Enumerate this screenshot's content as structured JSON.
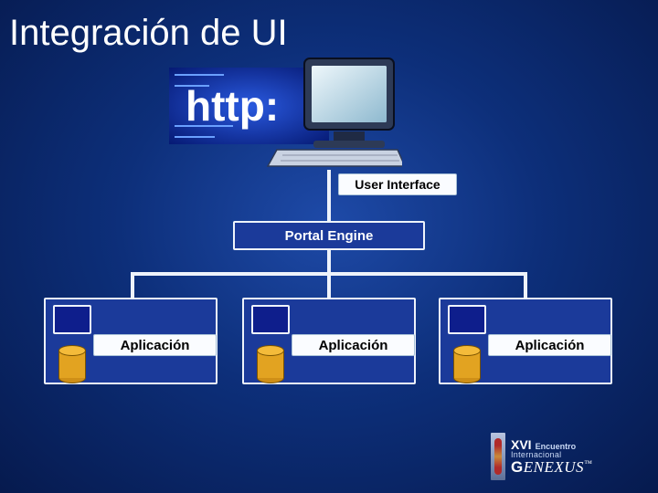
{
  "title": "Integración de UI",
  "http_text": "http:",
  "ui_label": "User Interface",
  "portal_label": "Portal Engine",
  "apps": [
    {
      "label": "Aplicación"
    },
    {
      "label": "Aplicación"
    },
    {
      "label": "Aplicación"
    }
  ],
  "logo": {
    "roman": "XVI",
    "line1": "Encuentro",
    "line2": "Internacional",
    "brand": "GeneXus"
  },
  "chart_data": {
    "type": "diagram",
    "title": "Integración de UI",
    "nodes": [
      {
        "id": "ui",
        "label": "User Interface",
        "note": "http browser/monitor image"
      },
      {
        "id": "portal",
        "label": "Portal Engine"
      },
      {
        "id": "app1",
        "label": "Aplicación",
        "has_db": true
      },
      {
        "id": "app2",
        "label": "Aplicación",
        "has_db": true
      },
      {
        "id": "app3",
        "label": "Aplicación",
        "has_db": true
      }
    ],
    "edges": [
      {
        "from": "ui",
        "to": "portal"
      },
      {
        "from": "portal",
        "to": "app1"
      },
      {
        "from": "portal",
        "to": "app2"
      },
      {
        "from": "portal",
        "to": "app3"
      }
    ],
    "layout": "tree, root=ui, fanout at portal to 3 apps"
  }
}
